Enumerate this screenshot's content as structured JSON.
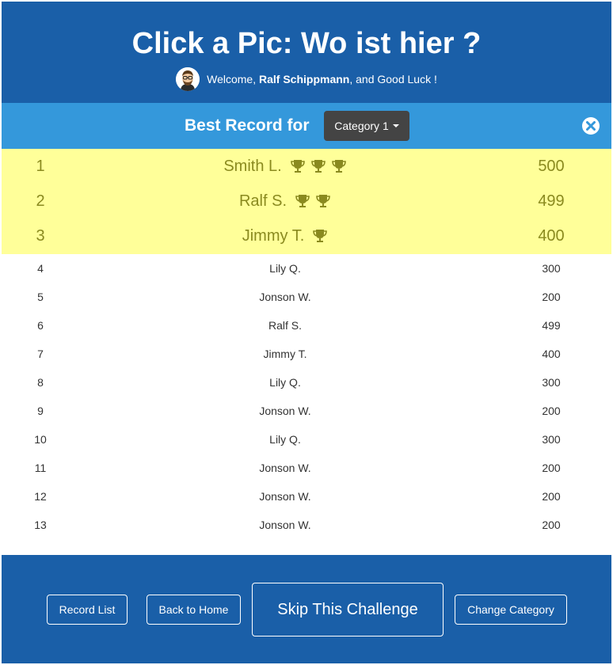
{
  "header": {
    "title": "Click a Pic: Wo ist hier ?",
    "welcome_prefix": "Welcome, ",
    "user_name": "Ralf Schippmann",
    "welcome_suffix": ", and Good Luck !"
  },
  "record_bar": {
    "label": "Best Record for",
    "category_selected": "Category 1"
  },
  "top_records": [
    {
      "rank": "1",
      "name": "Smith L.",
      "trophies": 3,
      "score": "500"
    },
    {
      "rank": "2",
      "name": "Ralf S.",
      "trophies": 2,
      "score": "499"
    },
    {
      "rank": "3",
      "name": "Jimmy T.",
      "trophies": 1,
      "score": "400"
    }
  ],
  "records": [
    {
      "rank": "4",
      "name": "Lily Q.",
      "score": "300"
    },
    {
      "rank": "5",
      "name": "Jonson W.",
      "score": "200"
    },
    {
      "rank": "6",
      "name": "Ralf S.",
      "score": "499"
    },
    {
      "rank": "7",
      "name": "Jimmy T.",
      "score": "400"
    },
    {
      "rank": "8",
      "name": "Lily Q.",
      "score": "300"
    },
    {
      "rank": "9",
      "name": "Jonson W.",
      "score": "200"
    },
    {
      "rank": "10",
      "name": "Lily Q.",
      "score": "300"
    },
    {
      "rank": "11",
      "name": "Jonson W.",
      "score": "200"
    },
    {
      "rank": "12",
      "name": "Jonson W.",
      "score": "200"
    },
    {
      "rank": "13",
      "name": "Jonson W.",
      "score": "200"
    }
  ],
  "footer": {
    "record_list": "Record List",
    "back_home": "Back to Home",
    "skip": "Skip This Challenge",
    "change_category": "Change Category"
  },
  "icons": {
    "avatar": "avatar-icon",
    "trophy": "trophy-icon",
    "close": "close-icon",
    "caret": "caret-down-icon"
  },
  "colors": {
    "header_bg": "#1a5fa8",
    "record_bar_bg": "#3498db",
    "top_rows_bg": "#ffff99",
    "top_rows_text": "#8a8a1f",
    "category_btn_bg": "#444444"
  }
}
